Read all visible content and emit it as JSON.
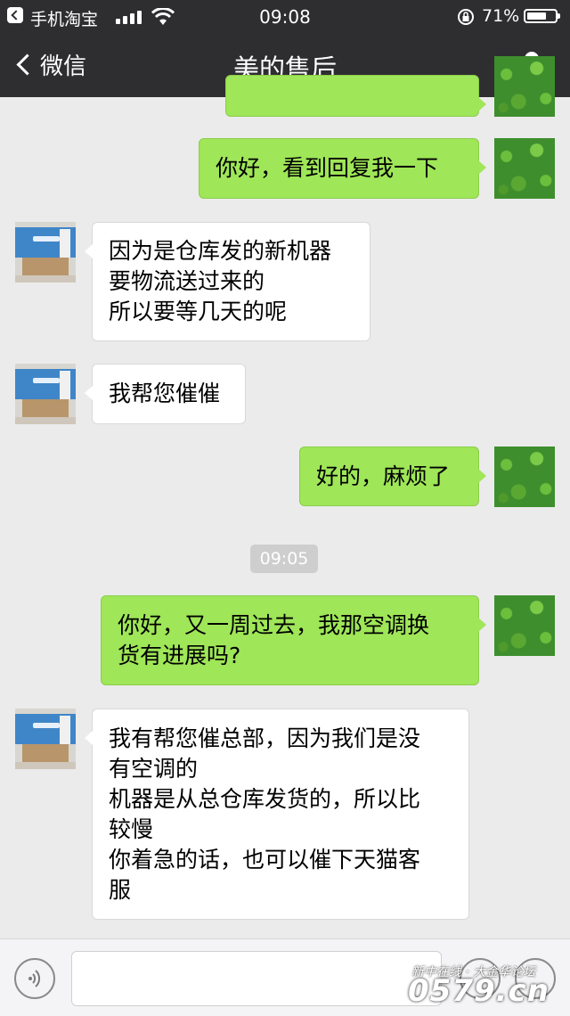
{
  "status_bar": {
    "back_app": "手机淘宝",
    "time": "09:08",
    "battery_percent": "71%",
    "battery_level": 0.71
  },
  "nav": {
    "back_label": "微信",
    "title": "美的售后"
  },
  "messages": [
    {
      "side": "out",
      "lines": [
        "你好，看到回复我一下"
      ]
    },
    {
      "side": "in",
      "lines": [
        "因为是仓库发的新机器",
        "要物流送过来的",
        "所以要等几天的呢"
      ]
    },
    {
      "side": "in",
      "lines": [
        "我帮您催催"
      ]
    },
    {
      "side": "out",
      "lines": [
        "好的，麻烦了"
      ]
    },
    {
      "side": "out",
      "lines": [
        "你好，又一周过去，我那空调换",
        "货有进展吗?"
      ]
    },
    {
      "side": "in",
      "lines": [
        "我有帮您催总部，因为我们是没",
        "有空调的",
        "机器是从总仓库发货的，所以比",
        "较慢",
        "你着急的话，也可以催下天猫客",
        "服"
      ]
    }
  ],
  "timestamp": "09:05",
  "watermark": {
    "line1": "新中在线 · 大金华论坛",
    "line2": "0579.cn"
  },
  "colors": {
    "outgoing_bubble": "#9fe658",
    "incoming_bubble": "#ffffff",
    "chat_background": "#ebebeb",
    "header_background": "#2e2e30"
  }
}
